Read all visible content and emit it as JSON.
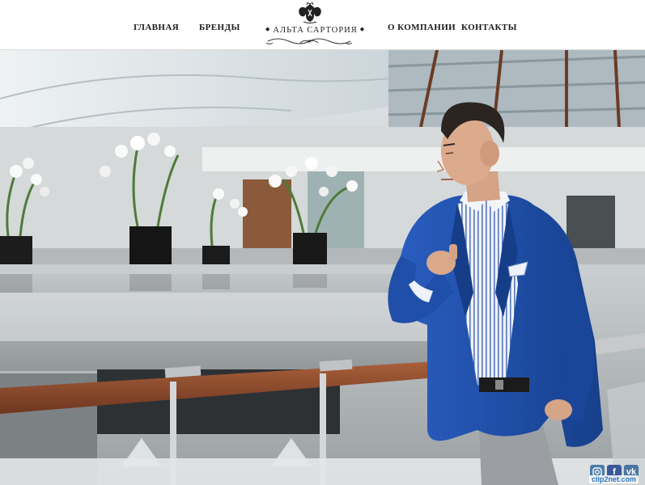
{
  "nav": {
    "home": "ГЛАВНАЯ",
    "brands": "БРЕНДЫ",
    "about": "О КОМПАНИИ",
    "contacts": "КОНТАКТЫ"
  },
  "logo": {
    "name": "АЛЬТА САРТОРИЯ"
  },
  "hero": {
    "image": "man-in-blue-blazer-leaning-on-railing"
  },
  "social": {
    "instagram": "instagram-icon",
    "facebook": "f",
    "vk": "vk"
  },
  "watermark": "clip2net.com",
  "colors": {
    "blazer": "#1f4fa8",
    "shirt": "#e6ecf5",
    "trousers": "#9b9ea3",
    "railing": "#8a4a2c",
    "header_bg": "#ffffff",
    "nav_text": "#1b1b1b"
  }
}
